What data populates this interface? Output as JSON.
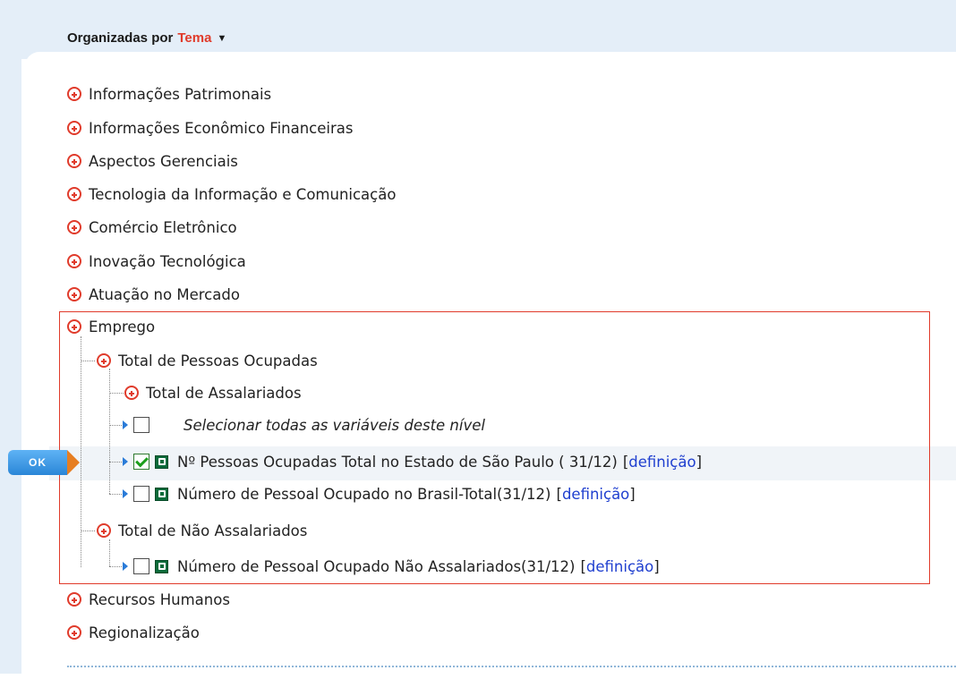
{
  "header": {
    "prefix": "Organizadas por",
    "accent": "Tema",
    "caret": "▼"
  },
  "categories": [
    {
      "label": "Informações Patrimonais"
    },
    {
      "label": "Informações Econômico Financeiras"
    },
    {
      "label": "Aspectos Gerenciais"
    },
    {
      "label": "Tecnologia da Informação e Comunicação"
    },
    {
      "label": "Comércio Eletrônico"
    },
    {
      "label": "Inovação Tecnológica"
    },
    {
      "label": "Atuação no Mercado"
    },
    {
      "label": "Emprego"
    }
  ],
  "emprego": {
    "total_ocupadas": "Total de Pessoas Ocupadas",
    "total_assalariados": "Total de Assalariados",
    "select_all": "Selecionar todas as variáveis deste nível",
    "items": [
      {
        "label": "Nº Pessoas Ocupadas Total no Estado de São Paulo ( 31/12)",
        "link": "definição",
        "checked": true
      },
      {
        "label": "Número de Pessoal Ocupado no Brasil-Total(31/12)",
        "link": "definição",
        "checked": false
      }
    ],
    "total_nao_assalariados": "Total de Não Assalariados",
    "nao_items": [
      {
        "label": "Número de Pessoal Ocupado Não Assalariados(31/12)",
        "link": "definição",
        "checked": false
      }
    ]
  },
  "bottom_categories": [
    {
      "label": "Recursos Humanos"
    },
    {
      "label": "Regionalização"
    }
  ],
  "ok_button": {
    "label": "OK"
  },
  "colors": {
    "accent": "#e03b2b",
    "link": "#1f3fcf",
    "header_band": "#e4eef8",
    "ok_blue": "#2a86d7",
    "ok_orange": "#e67e22"
  },
  "icons": {
    "expand": "plus-circle-icon",
    "query": "query-icon",
    "arrow": "arrow-right-icon"
  }
}
